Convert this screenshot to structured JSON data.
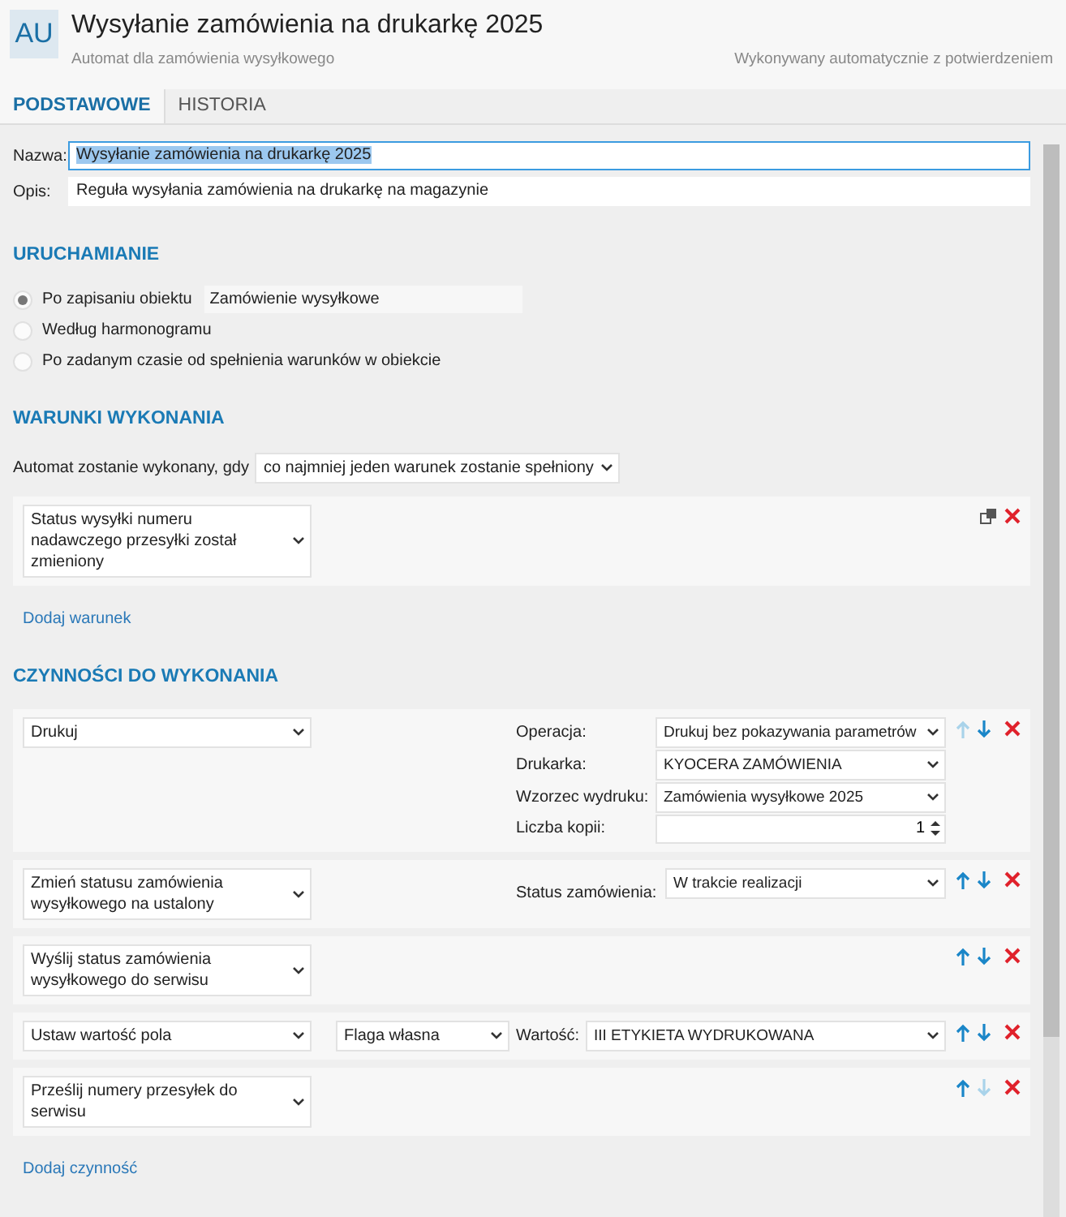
{
  "header": {
    "avatar": "AU",
    "title": "Wysyłanie zamówienia na drukarkę 2025",
    "subtitle": "Automat dla zamówienia wysyłkowego",
    "mode": "Wykonywany automatycznie z potwierdzeniem"
  },
  "tabs": [
    {
      "label": "PODSTAWOWE",
      "selected": true
    },
    {
      "label": "HISTORIA",
      "selected": false
    }
  ],
  "fields": [
    {
      "label": "Nazwa:",
      "value": "Wysyłanie zamówienia na drukarkę 2025",
      "focused": true
    },
    {
      "label": "Opis:",
      "value": "Reguła wysyłania zamówienia na drukarkę na magazynie",
      "focused": false
    }
  ],
  "trigger": {
    "title": "URUCHAMIANIE",
    "options": [
      {
        "label": "Po zapisaniu obiektu",
        "selected": true,
        "value": "Zamówienie wysyłkowe"
      },
      {
        "label": "Według harmonogramu",
        "selected": false
      },
      {
        "label": "Po zadanym czasie od spełnienia warunków w obiekcie",
        "selected": false
      }
    ]
  },
  "conditions": {
    "title": "WARUNKI WYKONANIA",
    "mode_label": "Automat zostanie wykonany, gdy",
    "mode_value": "co najmniej jeden warunek zostanie spełniony",
    "items": [
      {
        "text": "Status wysyłki numeru nadawczego przesyłki został zmieniony"
      }
    ],
    "add_link": "Dodaj warunek"
  },
  "actions": {
    "title": "CZYNNOŚCI DO WYKONANIA",
    "items": [
      {
        "action": "Drukuj",
        "up_disabled": true,
        "down_disabled": false,
        "params": [
          {
            "label": "Operacja:",
            "value": "Drukuj bez pokazywania parametrów",
            "kind": "select"
          },
          {
            "label": "Drukarka:",
            "value": "KYOCERA ZAMÓWIENIA",
            "kind": "select"
          },
          {
            "label": "Wzorzec wydruku:",
            "value": "Zamówienia wysyłkowe 2025",
            "kind": "select"
          },
          {
            "label": "Liczba kopii:",
            "value": "1",
            "kind": "number"
          }
        ]
      },
      {
        "action": "Zmień statusu zamówienia wysyłkowego na ustalony",
        "up_disabled": false,
        "down_disabled": false,
        "params": [
          {
            "label": "Status zamówienia:",
            "value": "W trakcie realizacji",
            "kind": "select"
          }
        ]
      },
      {
        "action": "Wyślij status zamówienia wysyłkowego do serwisu",
        "up_disabled": false,
        "down_disabled": false
      },
      {
        "action": "Ustaw wartość pola",
        "field": "Flaga własna",
        "up_disabled": false,
        "down_disabled": false,
        "params": [
          {
            "label": "Wartość:",
            "value": "III ETYKIETA WYDRUKOWANA",
            "kind": "select"
          }
        ]
      },
      {
        "action": "Prześlij numery przesyłek do serwisu",
        "up_disabled": false,
        "down_disabled": true
      }
    ],
    "add_link": "Dodaj czynność"
  }
}
